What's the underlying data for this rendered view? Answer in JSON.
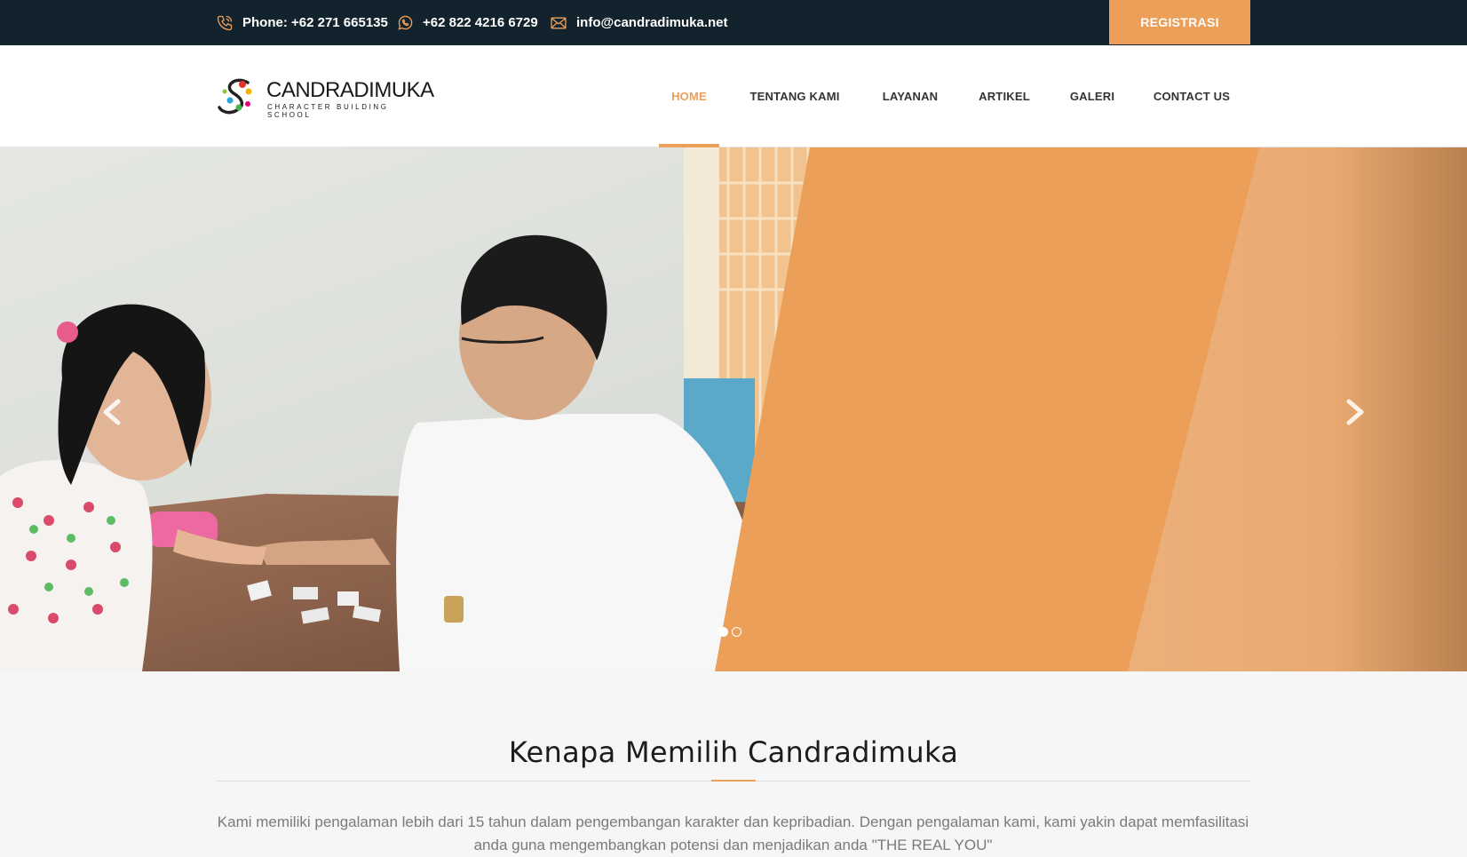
{
  "topbar": {
    "phone": "Phone: +62 271 665135",
    "whatsapp": "+62 822 4216 6729",
    "email": "info@candradimuka.net",
    "register_label": "REGISTRASI"
  },
  "brand": {
    "name": "CANDRADIMUKA",
    "tagline": "CHARACTER BUILDING SCHOOL"
  },
  "nav": {
    "items": [
      {
        "label": "HOME",
        "active": true
      },
      {
        "label": "TENTANG KAMI"
      },
      {
        "label": "LAYANAN"
      },
      {
        "label": "ARTIKEL"
      },
      {
        "label": "GALERI"
      },
      {
        "label": "CONTACT US"
      }
    ]
  },
  "slider": {
    "slide_count": 2,
    "active_slide": 1
  },
  "section": {
    "title": "Kenapa Memilih Candradimuka",
    "body": "Kami memiliki pengalaman lebih dari 15 tahun dalam pengembangan karakter dan kepribadian. Dengan pengalaman kami, kami yakin dapat memfasilitasi anda guna mengembangkan potensi dan menjadikan anda \"THE REAL YOU\""
  },
  "colors": {
    "accent": "#eb9f59",
    "topbar": "#13232e"
  }
}
